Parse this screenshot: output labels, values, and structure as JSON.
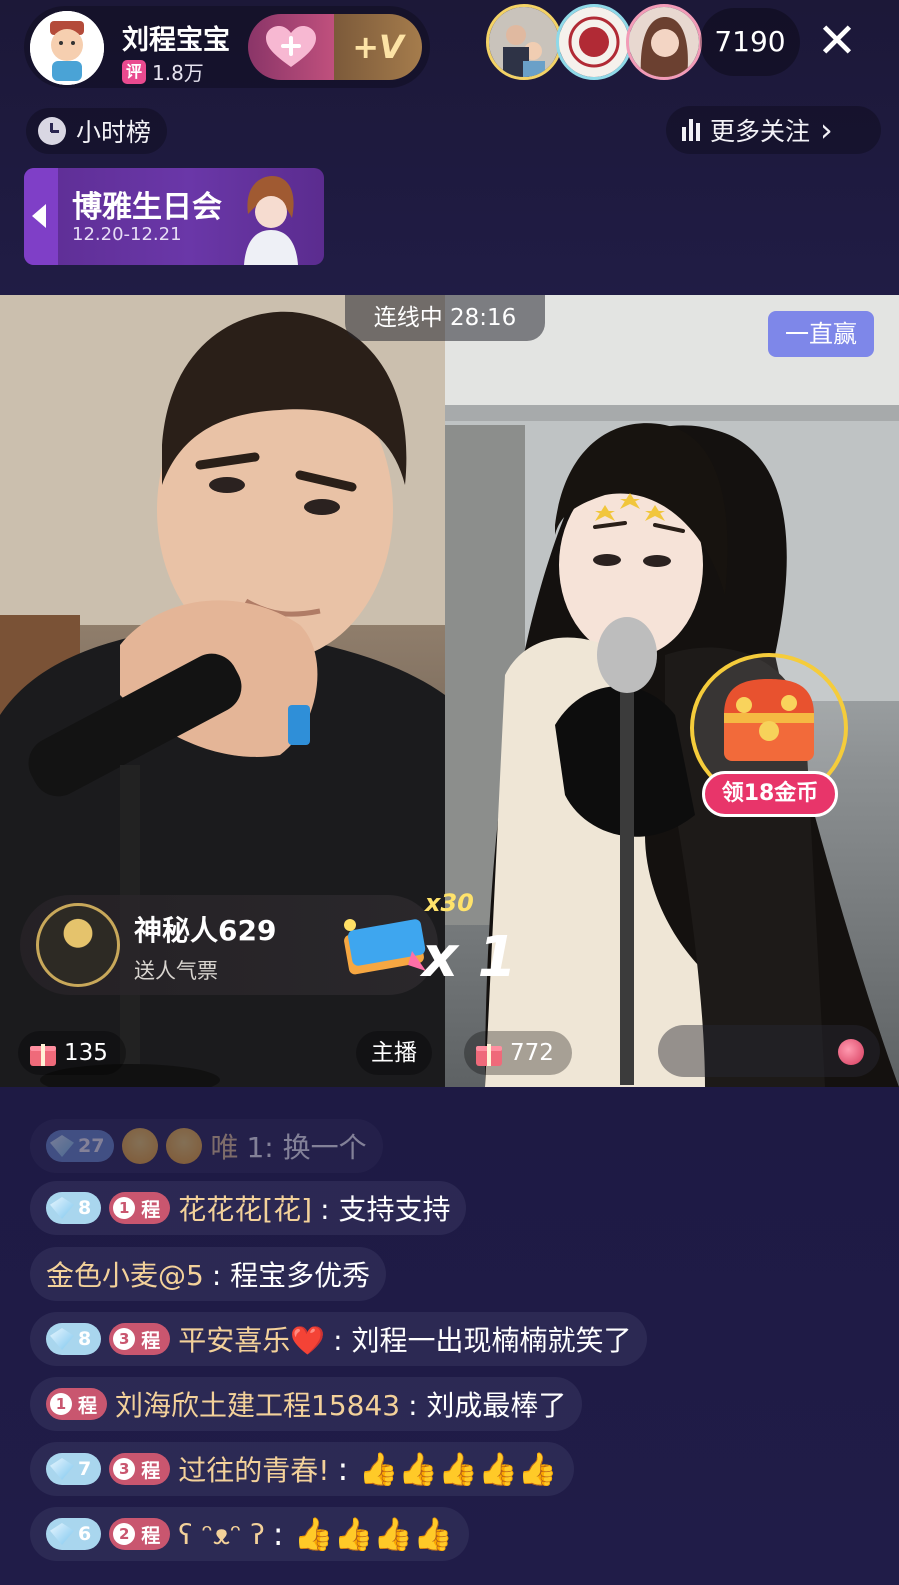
{
  "header": {
    "host_name": "刘程宝宝",
    "ping_badge": "评",
    "fans_count": "1.8万",
    "vip_label": "+V",
    "viewer_count": "7190",
    "close_glyph": "✕"
  },
  "nav": {
    "hourly_rank": "小时榜",
    "more_follow": "更多关注",
    "more_follow_chevron": "›"
  },
  "banner": {
    "title": "博雅生日会",
    "date": "12.20-12.21"
  },
  "video": {
    "lianxian": "连线中 28:16",
    "always_win": "一直赢",
    "gift": {
      "sender": "神秘人629",
      "action": "送人气票",
      "combo": "x30",
      "multiplier": "x 1"
    },
    "left_gift_count": "135",
    "host_tag": "主播",
    "right_gift_count": "772",
    "treasure_label": "领18金币"
  },
  "chat": {
    "messages": [
      {
        "level": "27",
        "fan_level": "",
        "fan_name": "",
        "name": "唯",
        "text": "1: 换一个",
        "dim": true
      },
      {
        "level": "8",
        "fan_level": "1",
        "fan_name": "程",
        "name": "花花花[花]",
        "text": ": 支持支持"
      },
      {
        "level": "",
        "fan_level": "",
        "fan_name": "",
        "name": "金色小麦@5",
        "text": ": 程宝多优秀"
      },
      {
        "level": "8",
        "fan_level": "3",
        "fan_name": "程",
        "name": "平安喜乐❤️",
        "text": ": 刘程一出现楠楠就笑了"
      },
      {
        "level": "",
        "fan_level": "1",
        "fan_name": "程",
        "name": "刘海欣土建工程15843",
        "text": ": 刘成最棒了"
      },
      {
        "level": "7",
        "fan_level": "3",
        "fan_name": "程",
        "name": "过往的青春!",
        "text": ": 👍👍👍👍👍"
      },
      {
        "level": "6",
        "fan_level": "2",
        "fan_name": "程",
        "name": "ʕ ᵔᴥᵔ ʔ",
        "text": ": 👍👍👍👍"
      }
    ]
  }
}
